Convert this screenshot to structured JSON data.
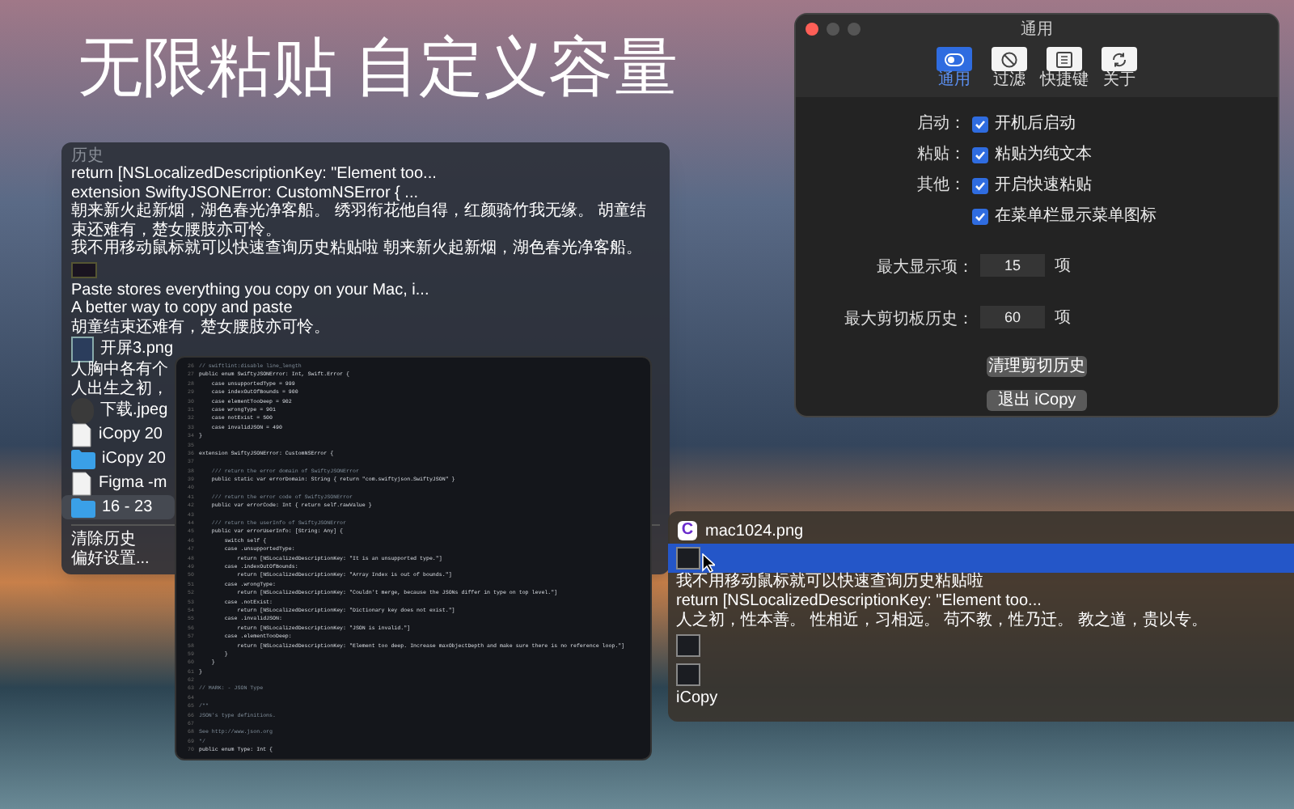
{
  "headline": "无限粘贴 自定义容量",
  "history_menu": {
    "title": "历史",
    "items": [
      {
        "kind": "text",
        "label": "return [NSLocalizedDescriptionKey: \"Element too...",
        "selected": false
      },
      {
        "kind": "text",
        "label": "extension SwiftyJSONError: CustomNSError {     ...",
        "selected": false
      },
      {
        "kind": "text",
        "label": "朝来新火起新烟，湖色春光净客船。 绣羽衔花他自得，红颜骑竹我无缘。 胡童结束还难有，楚女腰肢亦可怜。",
        "selected": false
      },
      {
        "kind": "text",
        "label": "我不用移动鼠标就可以快速查询历史粘贴啦 朝来新火起新烟，湖色春光净客船。",
        "selected": false
      },
      {
        "kind": "thumbnail",
        "selected": false
      },
      {
        "kind": "text",
        "label": "Paste stores everything you copy on your Mac, i...",
        "selected": false
      },
      {
        "kind": "text",
        "label": "A better way to copy and paste",
        "selected": false
      },
      {
        "kind": "text",
        "label": "胡童结束还难有，楚女腰肢亦可怜。",
        "selected": false
      },
      {
        "kind": "image-file",
        "label": "开屏3.png",
        "selected": false
      },
      {
        "kind": "text",
        "label": "人胸中各有个",
        "selected": false
      },
      {
        "kind": "text",
        "label": "人出生之初，",
        "selected": false
      },
      {
        "kind": "avatar-file",
        "label": "下载.jpeg",
        "selected": false
      },
      {
        "kind": "document",
        "label": "iCopy 20",
        "selected": false
      },
      {
        "kind": "folder",
        "label": "iCopy 20",
        "selected": false
      },
      {
        "kind": "document",
        "label": "Figma -m",
        "selected": false
      },
      {
        "kind": "folder",
        "label": "16 - 23",
        "selected": true
      }
    ],
    "footer": [
      "清除历史",
      "偏好设置..."
    ]
  },
  "code_window": {
    "lines": [
      {
        "number": "26",
        "code": "// swiftlint:disable line_length",
        "kind": "comment"
      },
      {
        "number": "27",
        "code": "public enum SwiftyJSONError: Int, Swift.Error {",
        "kind": "code"
      },
      {
        "number": "28",
        "code": "    case unsupportedType = 999",
        "kind": "code"
      },
      {
        "number": "29",
        "code": "    case indexOutOfBounds = 900",
        "kind": "code"
      },
      {
        "number": "30",
        "code": "    case elementTooDeep = 902",
        "kind": "code"
      },
      {
        "number": "31",
        "code": "    case wrongType = 901",
        "kind": "code"
      },
      {
        "number": "32",
        "code": "    case notExist = 500",
        "kind": "code"
      },
      {
        "number": "33",
        "code": "    case invalidJSON = 490",
        "kind": "code"
      },
      {
        "number": "34",
        "code": "}",
        "kind": "code"
      },
      {
        "number": "35"
      },
      {
        "number": "36",
        "code": "extension SwiftyJSONError: CustomNSError {",
        "kind": "code"
      },
      {
        "number": "37"
      },
      {
        "number": "38",
        "code": "    /// return the error domain of SwiftyJSONError",
        "kind": "comment"
      },
      {
        "number": "39",
        "code": "    public static var errorDomain: String { return \"com.swiftyjson.SwiftyJSON\" }",
        "kind": "code"
      },
      {
        "number": "40"
      },
      {
        "number": "41",
        "code": "    /// return the error code of SwiftyJSONError",
        "kind": "comment"
      },
      {
        "number": "42",
        "code": "    public var errorCode: Int { return self.rawValue }",
        "kind": "code"
      },
      {
        "number": "43"
      },
      {
        "number": "44",
        "code": "    /// return the userInfo of SwiftyJSONError",
        "kind": "comment"
      },
      {
        "number": "45",
        "code": "    public var errorUserInfo: [String: Any] {",
        "kind": "code"
      },
      {
        "number": "46",
        "code": "        switch self {",
        "kind": "code"
      },
      {
        "number": "47",
        "code": "        case .unsupportedType:",
        "kind": "code"
      },
      {
        "number": "48",
        "code": "            return [NSLocalizedDescriptionKey: \"It is an unsupported type.\"]",
        "kind": "code"
      },
      {
        "number": "49",
        "code": "        case .indexOutOfBounds:",
        "kind": "code"
      },
      {
        "number": "50",
        "code": "            return [NSLocalizedDescriptionKey: \"Array Index is out of bounds.\"]",
        "kind": "code"
      },
      {
        "number": "51",
        "code": "        case .wrongType:",
        "kind": "code"
      },
      {
        "number": "52",
        "code": "            return [NSLocalizedDescriptionKey: \"Couldn't merge, because the JSONs differ in type on top level.\"]",
        "kind": "code"
      },
      {
        "number": "53",
        "code": "        case .notExist:",
        "kind": "code"
      },
      {
        "number": "54",
        "code": "            return [NSLocalizedDescriptionKey: \"Dictionary key does not exist.\"]",
        "kind": "code"
      },
      {
        "number": "55",
        "code": "        case .invalidJSON:",
        "kind": "code"
      },
      {
        "number": "56",
        "code": "            return [NSLocalizedDescriptionKey: \"JSON is invalid.\"]",
        "kind": "code"
      },
      {
        "number": "57",
        "code": "        case .elementTooDeep:",
        "kind": "code"
      },
      {
        "number": "58",
        "code": "            return [NSLocalizedDescriptionKey: \"Element too deep. Increase maxObjectDepth and make sure there is no reference loop.\"]",
        "kind": "code"
      },
      {
        "number": "59",
        "code": "        }",
        "kind": "code"
      },
      {
        "number": "60",
        "code": "    }",
        "kind": "code"
      },
      {
        "number": "61",
        "code": "}",
        "kind": "code"
      },
      {
        "number": "62"
      },
      {
        "number": "63",
        "code": "// MARK: - JSON Type",
        "kind": "comment"
      },
      {
        "number": "64"
      },
      {
        "number": "65",
        "code": "/**",
        "kind": "comment"
      },
      {
        "number": "66",
        "code": "JSON's type definitions.",
        "kind": "comment"
      },
      {
        "number": "67"
      },
      {
        "number": "68",
        "code": "See http://www.json.org",
        "kind": "comment"
      },
      {
        "number": "69",
        "code": "*/",
        "kind": "comment"
      },
      {
        "number": "70",
        "code": "public enum Type: Int {",
        "kind": "code"
      }
    ]
  },
  "settings_window": {
    "title": "通用",
    "tabs": [
      {
        "label": "通用",
        "selected": true
      },
      {
        "label": "过滤",
        "selected": false
      },
      {
        "label": "快捷键",
        "selected": false
      },
      {
        "label": "关于",
        "selected": false
      }
    ],
    "checkbox_rows": [
      {
        "label": "启动：",
        "option": "开机后启动",
        "checked": true
      },
      {
        "label": "粘贴：",
        "option": "粘贴为纯文本",
        "checked": true
      },
      {
        "label": "其他：",
        "option": "开启快速粘贴",
        "checked": true
      },
      {
        "option": "在菜单栏显示菜单图标",
        "checked": true
      }
    ],
    "number_fields": [
      {
        "label": "最大显示项：",
        "value": "15",
        "unit": "项"
      },
      {
        "label": "最大剪切板历史：",
        "value": "60",
        "unit": "项"
      }
    ],
    "buttons": [
      "清理剪切历史",
      "退出 iCopy"
    ]
  },
  "quick_paste_popup": {
    "app_icon_letter": "C",
    "file_name": "mac1024.png",
    "items": [
      {
        "kind": "thumbnail",
        "selected": true
      },
      {
        "kind": "text",
        "label": "我不用移动鼠标就可以快速查询历史粘贴啦",
        "selected": false
      },
      {
        "kind": "text",
        "label": "return [NSLocalizedDescriptionKey: \"Element too...",
        "selected": false
      },
      {
        "kind": "text",
        "label": "人之初，性本善。 性相近，习相远。 苟不教，性乃迁。 教之道，贵以专。",
        "selected": false
      },
      {
        "kind": "thumbnail",
        "selected": false
      },
      {
        "kind": "thumbnail",
        "selected": false
      },
      {
        "kind": "text",
        "label": "iCopy",
        "selected": false
      }
    ]
  }
}
